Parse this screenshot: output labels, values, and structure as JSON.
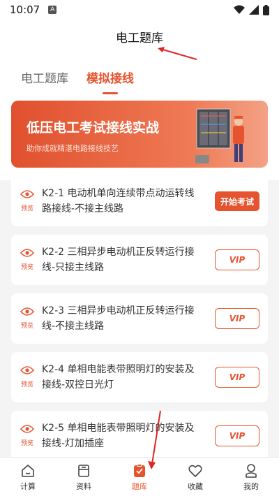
{
  "status_bar": {
    "time": "10:07",
    "notif_letter": "A"
  },
  "header": {
    "title": "电工题库"
  },
  "tabs": [
    {
      "label": "电工题库",
      "active": false
    },
    {
      "label": "模拟接线",
      "active": true
    }
  ],
  "banner": {
    "title": "低压电工考试接线实战",
    "subtitle": "助你成就精湛电路接线技艺"
  },
  "preview_label": "预览",
  "cards": [
    {
      "title": "K2-1 电动机单向连续带点动运转线路接线-不接主线路",
      "action": "开始考试",
      "locked": false
    },
    {
      "title": "K2-2 三相异步电动机正反转运行接线-只接主线路",
      "action": "VIP",
      "locked": true
    },
    {
      "title": "K2-3 三相异步电动机正反转运行接线-不接主线路",
      "action": "VIP",
      "locked": true
    },
    {
      "title": "K2-4 单相电能表带照明灯的安装及接线-双控日光灯",
      "action": "VIP",
      "locked": true
    },
    {
      "title": "K2-5 单相电能表带照明灯的安装及接线-灯加插座",
      "action": "VIP",
      "locked": true
    }
  ],
  "bottom_nav": [
    {
      "label": "计算",
      "icon": "home-icon",
      "active": false
    },
    {
      "label": "资料",
      "icon": "document-icon",
      "active": false
    },
    {
      "label": "题库",
      "icon": "question-bank-icon",
      "active": true
    },
    {
      "label": "收藏",
      "icon": "heart-icon",
      "active": false
    },
    {
      "label": "我的",
      "icon": "profile-icon",
      "active": false
    }
  ],
  "colors": {
    "accent": "#e5542f",
    "background": "#f4f4f4"
  }
}
